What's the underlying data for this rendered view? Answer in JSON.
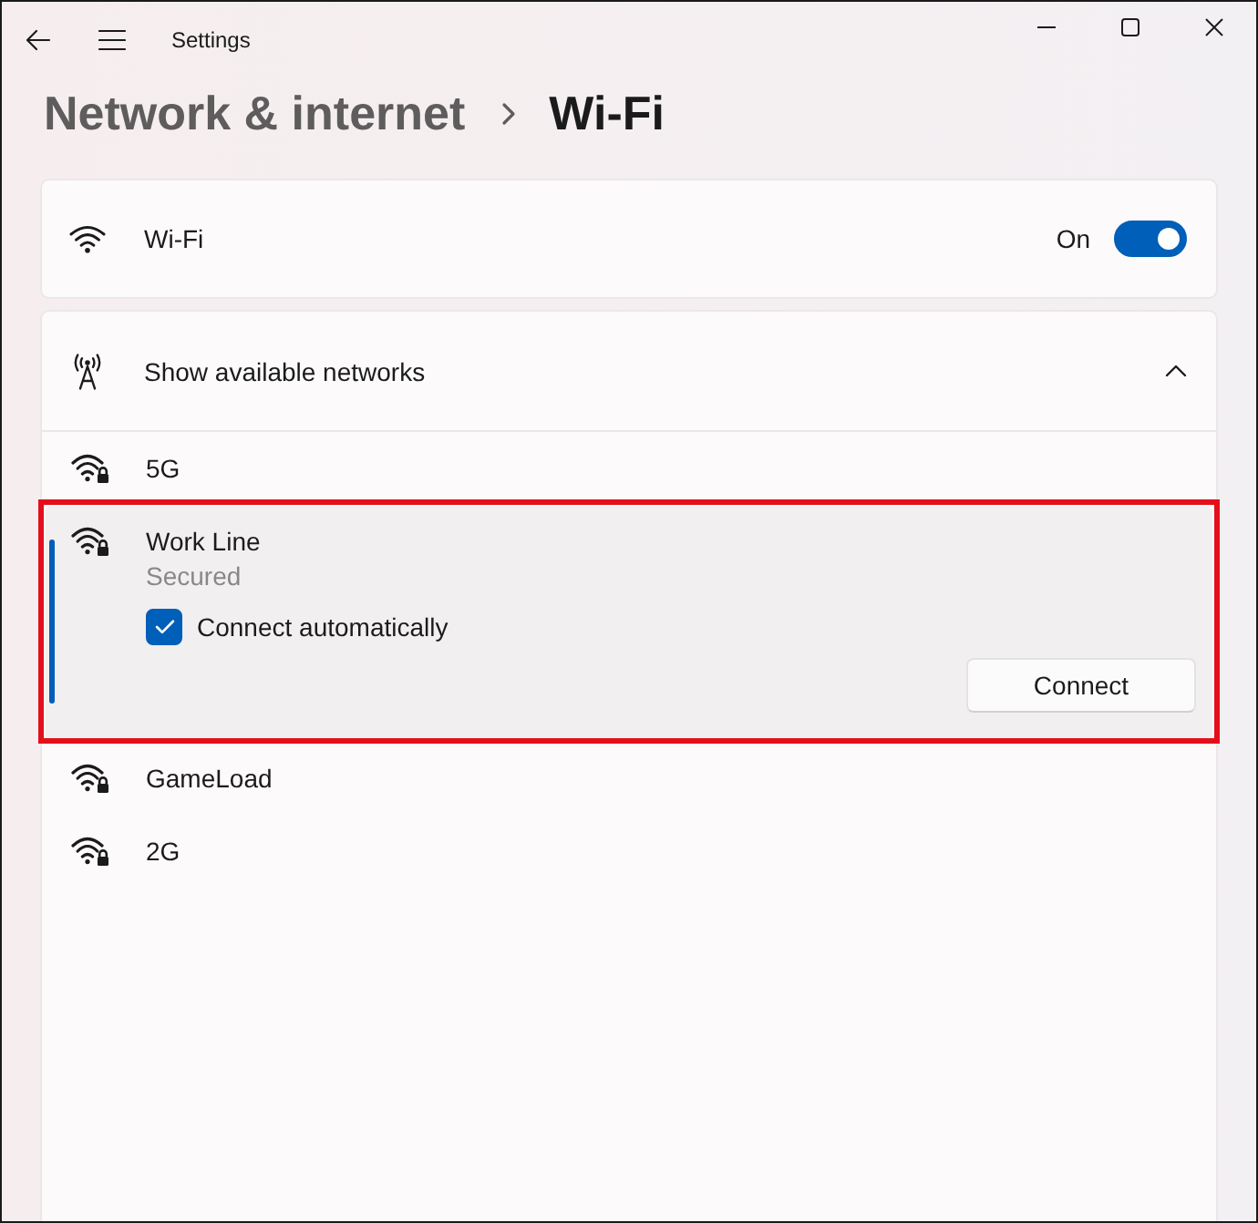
{
  "window": {
    "title": "Settings"
  },
  "breadcrumb": [
    {
      "label": "Network & internet",
      "current": false
    },
    {
      "label": "Wi-Fi",
      "current": true
    }
  ],
  "wifi": {
    "label": "Wi-Fi",
    "state_label": "On",
    "on": true
  },
  "available_networks": {
    "label": "Show available networks",
    "expanded": true,
    "networks": [
      {
        "name": "5G",
        "selected": false,
        "expanded": false,
        "highlighted": false
      },
      {
        "name": "Work Line",
        "selected": true,
        "expanded": true,
        "highlighted": true,
        "status": "Secured",
        "connect_automatically": {
          "label": "Connect automatically",
          "checked": true
        },
        "button": "Connect"
      },
      {
        "name": "GameLoad",
        "selected": false,
        "expanded": false,
        "highlighted": false
      },
      {
        "name": "2G",
        "selected": false,
        "expanded": false,
        "highlighted": false
      }
    ]
  }
}
